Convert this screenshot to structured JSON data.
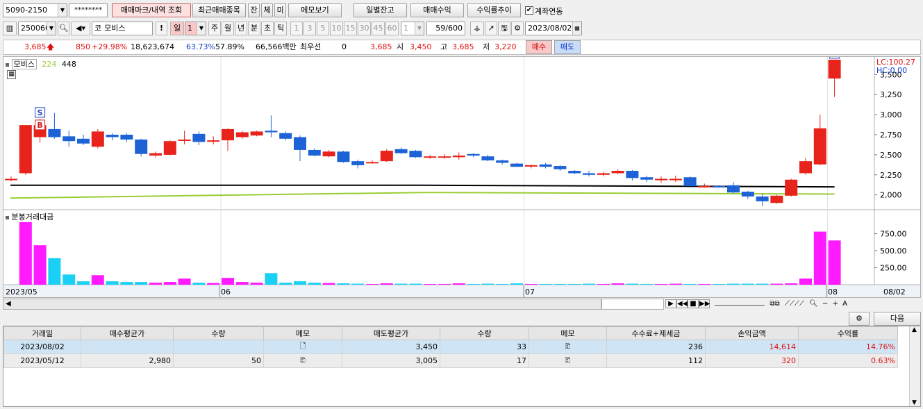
{
  "toolbar1": {
    "account": "5090-2150",
    "password": "********",
    "buttons": [
      "매매마크/내역 조회",
      "최근매매종목",
      "잔",
      "체",
      "미",
      "메모보기",
      "일별잔고",
      "매매수익",
      "수익률추이"
    ],
    "link_label": "계좌연동",
    "link_checked": true
  },
  "toolbar2": {
    "code": "250060",
    "market_prefix": "코",
    "stock_name": "모비스",
    "excl": "!",
    "period_selected": "일",
    "period_value": "1",
    "periods": [
      "주",
      "월",
      "년",
      "분",
      "초",
      "틱"
    ],
    "minutes": [
      "1",
      "3",
      "5",
      "10",
      "15",
      "30",
      "45",
      "60"
    ],
    "minute_value": "1",
    "count": "59",
    "count_total": "/600",
    "date": "2023/08/02"
  },
  "quote": {
    "price": "3,685",
    "change": "850",
    "change_pct": "+29.98%",
    "volume": "18,623,674",
    "rate1": "63.73%",
    "rate2": "57.89%",
    "amount": "66,566백만",
    "priority_label": "최우선",
    "priority_value": "0",
    "bid": "3,685",
    "open_label": "시",
    "open": "3,450",
    "high_label": "고",
    "high": "3,685",
    "low_label": "저",
    "low": "3,220",
    "buy_button": "매수",
    "sell_button": "매도"
  },
  "chart": {
    "legend_name": "모비스",
    "legend_ma1": "224",
    "legend_ma2": "448",
    "lc_label": "LC:100.27",
    "hc_label": "HC:0.00",
    "volume_title": "분봉거래대금",
    "colors": {
      "up": "#e8231b",
      "down": "#1e63d6",
      "vol_up": "#ff1aff",
      "vol_down": "#1ad1f5",
      "ma_black": "#000000",
      "ma_green": "#9acd32"
    }
  },
  "chart_data": {
    "type": "candlestick",
    "price_axis_ticks": [
      "3,500",
      "3,250",
      "3,000",
      "2,750",
      "2,500",
      "2,250",
      "2,000"
    ],
    "volume_axis_ticks": [
      "750.00",
      "500.00",
      "250.00"
    ],
    "date_labels": [
      "2023/05",
      "06",
      "07",
      "08",
      "08/02"
    ],
    "ylim": [
      1850,
      3650
    ],
    "volume_ylim": [
      0,
      1000
    ],
    "candles": [
      {
        "o": 2200,
        "h": 2230,
        "l": 2170,
        "c": 2200,
        "v": 0
      },
      {
        "o": 2270,
        "h": 2870,
        "l": 2250,
        "c": 2870,
        "v": 920
      },
      {
        "o": 2720,
        "h": 2950,
        "l": 2650,
        "c": 2870,
        "v": 580
      },
      {
        "o": 2820,
        "h": 3020,
        "l": 2700,
        "c": 2720,
        "v": 390
      },
      {
        "o": 2730,
        "h": 2800,
        "l": 2600,
        "c": 2670,
        "v": 150
      },
      {
        "o": 2700,
        "h": 2750,
        "l": 2620,
        "c": 2640,
        "v": 50
      },
      {
        "o": 2600,
        "h": 2820,
        "l": 2580,
        "c": 2790,
        "v": 140
      },
      {
        "o": 2750,
        "h": 2770,
        "l": 2680,
        "c": 2720,
        "v": 50
      },
      {
        "o": 2750,
        "h": 2770,
        "l": 2660,
        "c": 2690,
        "v": 40
      },
      {
        "o": 2690,
        "h": 2700,
        "l": 2480,
        "c": 2510,
        "v": 40
      },
      {
        "o": 2490,
        "h": 2540,
        "l": 2470,
        "c": 2520,
        "v": 30
      },
      {
        "o": 2500,
        "h": 2680,
        "l": 2490,
        "c": 2670,
        "v": 40
      },
      {
        "o": 2680,
        "h": 2800,
        "l": 2630,
        "c": 2690,
        "v": 90
      },
      {
        "o": 2760,
        "h": 2790,
        "l": 2620,
        "c": 2660,
        "v": 30
      },
      {
        "o": 2680,
        "h": 2730,
        "l": 2630,
        "c": 2680,
        "v": 25
      },
      {
        "o": 2680,
        "h": 2830,
        "l": 2550,
        "c": 2820,
        "v": 100
      },
      {
        "o": 2720,
        "h": 2800,
        "l": 2700,
        "c": 2780,
        "v": 40
      },
      {
        "o": 2740,
        "h": 2800,
        "l": 2730,
        "c": 2790,
        "v": 30
      },
      {
        "o": 2800,
        "h": 2990,
        "l": 2720,
        "c": 2780,
        "v": 170
      },
      {
        "o": 2770,
        "h": 2790,
        "l": 2680,
        "c": 2700,
        "v": 30
      },
      {
        "o": 2720,
        "h": 2740,
        "l": 2420,
        "c": 2560,
        "v": 50
      },
      {
        "o": 2560,
        "h": 2580,
        "l": 2480,
        "c": 2490,
        "v": 30
      },
      {
        "o": 2480,
        "h": 2560,
        "l": 2470,
        "c": 2540,
        "v": 25
      },
      {
        "o": 2540,
        "h": 2550,
        "l": 2400,
        "c": 2410,
        "v": 20
      },
      {
        "o": 2420,
        "h": 2440,
        "l": 2330,
        "c": 2370,
        "v": 15
      },
      {
        "o": 2400,
        "h": 2430,
        "l": 2390,
        "c": 2410,
        "v": 10
      },
      {
        "o": 2420,
        "h": 2570,
        "l": 2410,
        "c": 2550,
        "v": 20
      },
      {
        "o": 2570,
        "h": 2590,
        "l": 2510,
        "c": 2520,
        "v": 15
      },
      {
        "o": 2550,
        "h": 2560,
        "l": 2460,
        "c": 2470,
        "v": 15
      },
      {
        "o": 2470,
        "h": 2500,
        "l": 2450,
        "c": 2480,
        "v": 10
      },
      {
        "o": 2470,
        "h": 2510,
        "l": 2450,
        "c": 2480,
        "v": 10
      },
      {
        "o": 2470,
        "h": 2530,
        "l": 2440,
        "c": 2490,
        "v": 20
      },
      {
        "o": 2510,
        "h": 2520,
        "l": 2470,
        "c": 2490,
        "v": 10
      },
      {
        "o": 2480,
        "h": 2500,
        "l": 2420,
        "c": 2430,
        "v": 15
      },
      {
        "o": 2430,
        "h": 2440,
        "l": 2380,
        "c": 2400,
        "v": 10
      },
      {
        "o": 2390,
        "h": 2400,
        "l": 2360,
        "c": 2350,
        "v": 20
      },
      {
        "o": 2360,
        "h": 2380,
        "l": 2330,
        "c": 2370,
        "v": 10
      },
      {
        "o": 2380,
        "h": 2400,
        "l": 2330,
        "c": 2350,
        "v": 10
      },
      {
        "o": 2360,
        "h": 2370,
        "l": 2300,
        "c": 2320,
        "v": 10
      },
      {
        "o": 2300,
        "h": 2310,
        "l": 2260,
        "c": 2270,
        "v": 10
      },
      {
        "o": 2270,
        "h": 2300,
        "l": 2230,
        "c": 2250,
        "v": 15
      },
      {
        "o": 2250,
        "h": 2290,
        "l": 2230,
        "c": 2270,
        "v": 10
      },
      {
        "o": 2270,
        "h": 2320,
        "l": 2260,
        "c": 2300,
        "v": 20
      },
      {
        "o": 2300,
        "h": 2310,
        "l": 2180,
        "c": 2210,
        "v": 15
      },
      {
        "o": 2220,
        "h": 2240,
        "l": 2160,
        "c": 2190,
        "v": 10
      },
      {
        "o": 2190,
        "h": 2230,
        "l": 2150,
        "c": 2200,
        "v": 10
      },
      {
        "o": 2190,
        "h": 2240,
        "l": 2160,
        "c": 2200,
        "v": 15
      },
      {
        "o": 2220,
        "h": 2230,
        "l": 2090,
        "c": 2110,
        "v": 10
      },
      {
        "o": 2110,
        "h": 2140,
        "l": 2090,
        "c": 2110,
        "v": 10
      },
      {
        "o": 2110,
        "h": 2120,
        "l": 2090,
        "c": 2100,
        "v": 10
      },
      {
        "o": 2120,
        "h": 2160,
        "l": 2020,
        "c": 2030,
        "v": 15
      },
      {
        "o": 2040,
        "h": 2050,
        "l": 1950,
        "c": 1980,
        "v": 15
      },
      {
        "o": 1980,
        "h": 2010,
        "l": 1860,
        "c": 1920,
        "v": 15
      },
      {
        "o": 1900,
        "h": 2000,
        "l": 1890,
        "c": 1990,
        "v": 15
      },
      {
        "o": 1990,
        "h": 2200,
        "l": 1980,
        "c": 2190,
        "v": 20
      },
      {
        "o": 2270,
        "h": 2460,
        "l": 2250,
        "c": 2420,
        "v": 90
      },
      {
        "o": 2380,
        "h": 3000,
        "l": 2370,
        "c": 2830,
        "v": 780
      },
      {
        "o": 3450,
        "h": 3685,
        "l": 3220,
        "c": 3685,
        "v": 650
      }
    ],
    "marks": [
      {
        "index": 2,
        "sell": "S",
        "buy": "B"
      },
      {
        "index": 57,
        "sell": "S"
      }
    ],
    "ma_black": [
      2120,
      2120,
      2100
    ],
    "ma_green": [
      1960,
      2030,
      2010
    ]
  },
  "scrollbar": {
    "left_arrow": "◀"
  },
  "grid": {
    "next_button": "다음",
    "columns": [
      "거래일",
      "매수평균가",
      "수량",
      "메모",
      "매도평균가",
      "수량",
      "메모",
      "수수료+제세금",
      "손익금액",
      "수익률"
    ],
    "rows": [
      {
        "date": "2023/08/02",
        "buy_avg": "",
        "buy_qty": "",
        "sell_avg": "3,450",
        "sell_qty": "33",
        "fee": "236",
        "pnl": "14,614",
        "rate": "14.76%"
      },
      {
        "date": "2023/05/12",
        "buy_avg": "2,980",
        "buy_qty": "50",
        "sell_avg": "3,005",
        "sell_qty": "17",
        "fee": "112",
        "pnl": "320",
        "rate": "0.63%"
      }
    ]
  }
}
